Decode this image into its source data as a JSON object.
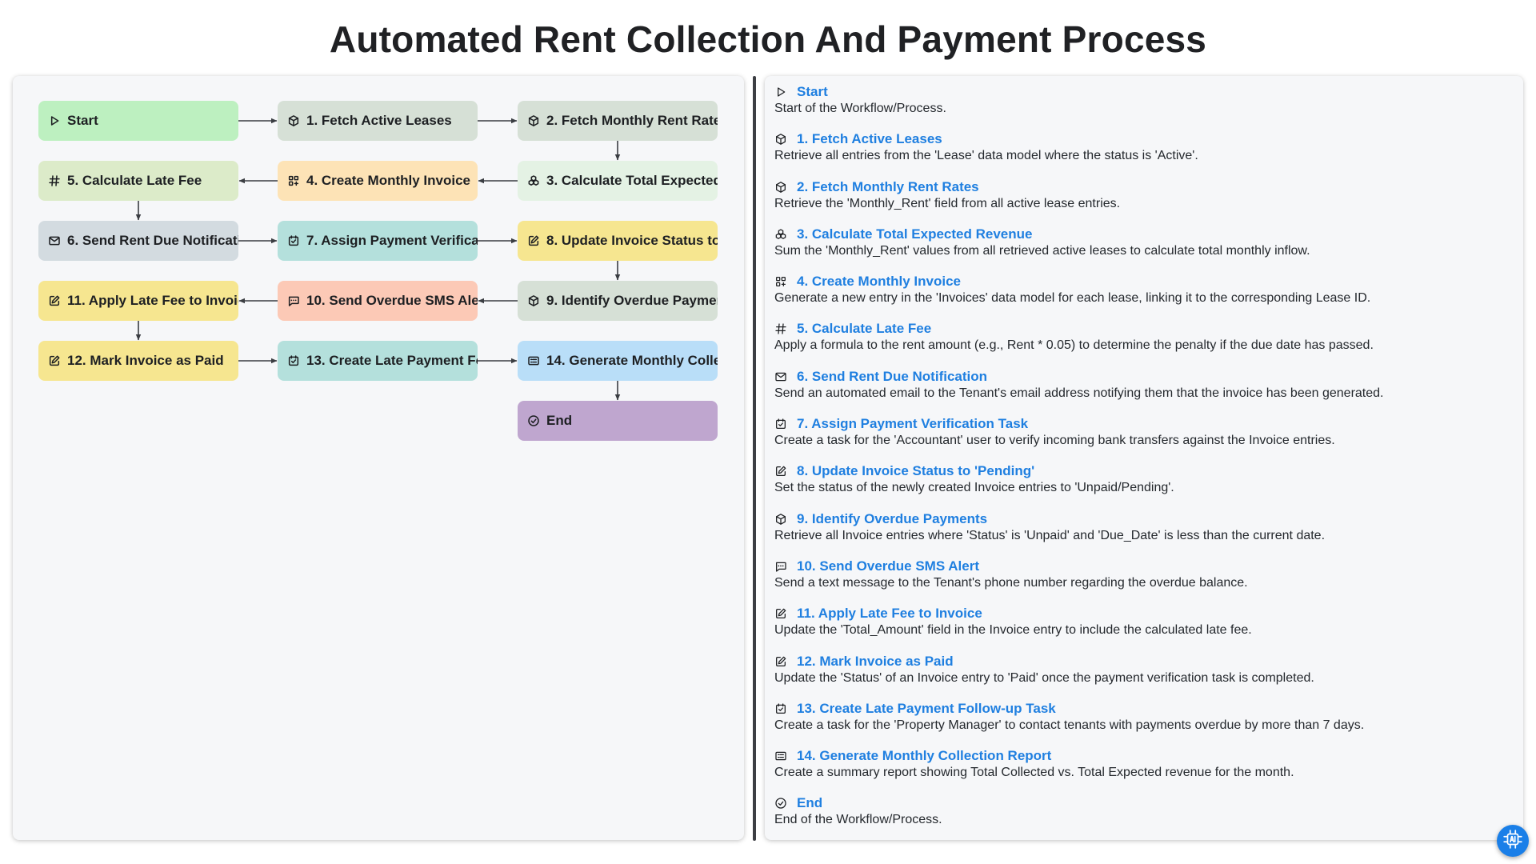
{
  "title": "Automated Rent Collection And Payment Process",
  "colors": {
    "green": "#bdf0c0",
    "gray_green": "#d6e0d6",
    "pale_green": "#e4f2e4",
    "orange": "#fde3b6",
    "lime": "#dcebc9",
    "slate": "#d3dbe0",
    "teal": "#b4e0dc",
    "yellow": "#f6e690",
    "salmon": "#fcc9b6",
    "blue": "#b9def8",
    "purple": "#bfa6cf",
    "link": "#1f7fe0"
  },
  "flow": {
    "nodes": [
      {
        "id": "start",
        "label": "Start",
        "icon": "play-icon"
      },
      {
        "id": "n1",
        "label": "1. Fetch Active Leases",
        "icon": "cube-icon"
      },
      {
        "id": "n2",
        "label": "2. Fetch Monthly Rent Rate",
        "icon": "cube-icon"
      },
      {
        "id": "n3",
        "label": "3. Calculate Total Expected",
        "icon": "cubes-icon"
      },
      {
        "id": "n4",
        "label": "4. Create Monthly Invoice",
        "icon": "grid-plus-icon"
      },
      {
        "id": "n5",
        "label": "5. Calculate Late Fee",
        "icon": "hash-icon"
      },
      {
        "id": "n6",
        "label": "6. Send Rent Due Notificati",
        "icon": "mail-icon"
      },
      {
        "id": "n7",
        "label": "7. Assign Payment Verificat",
        "icon": "calendar-check-icon"
      },
      {
        "id": "n8",
        "label": "8. Update Invoice Status to",
        "icon": "edit-icon"
      },
      {
        "id": "n9",
        "label": "9. Identify Overdue Paymer",
        "icon": "cube-icon"
      },
      {
        "id": "n10",
        "label": "10. Send Overdue SMS Ale",
        "icon": "message-icon"
      },
      {
        "id": "n11",
        "label": "11. Apply Late Fee to Invoic",
        "icon": "edit-icon"
      },
      {
        "id": "n12",
        "label": "12. Mark Invoice as Paid",
        "icon": "edit-icon"
      },
      {
        "id": "n13",
        "label": "13. Create Late Payment Fc",
        "icon": "calendar-check-icon"
      },
      {
        "id": "n14",
        "label": "14. Generate Monthly Colle",
        "icon": "report-icon"
      },
      {
        "id": "end",
        "label": "End",
        "icon": "check-circle-icon"
      }
    ]
  },
  "steps": [
    {
      "icon": "play-icon",
      "title": "Start",
      "desc": "Start of the Workflow/Process."
    },
    {
      "icon": "cube-icon",
      "title": "1. Fetch Active Leases",
      "desc": "Retrieve all entries from the 'Lease' data model where the status is 'Active'."
    },
    {
      "icon": "cube-icon",
      "title": "2. Fetch Monthly Rent Rates",
      "desc": "Retrieve the 'Monthly_Rent' field from all active lease entries."
    },
    {
      "icon": "cubes-icon",
      "title": "3. Calculate Total Expected Revenue",
      "desc": "Sum the 'Monthly_Rent' values from all retrieved active leases to calculate total monthly inflow."
    },
    {
      "icon": "grid-plus-icon",
      "title": "4. Create Monthly Invoice",
      "desc": "Generate a new entry in the 'Invoices' data model for each lease, linking it to the corresponding Lease ID."
    },
    {
      "icon": "hash-icon",
      "title": "5. Calculate Late Fee",
      "desc": "Apply a formula to the rent amount (e.g., Rent * 0.05) to determine the penalty if the due date has passed."
    },
    {
      "icon": "mail-icon",
      "title": "6. Send Rent Due Notification",
      "desc": "Send an automated email to the Tenant's email address notifying them that the invoice has been generated."
    },
    {
      "icon": "calendar-check-icon",
      "title": "7. Assign Payment Verification Task",
      "desc": "Create a task for the 'Accountant' user to verify incoming bank transfers against the Invoice entries."
    },
    {
      "icon": "edit-icon",
      "title": "8. Update Invoice Status to 'Pending'",
      "desc": "Set the status of the newly created Invoice entries to 'Unpaid/Pending'."
    },
    {
      "icon": "cube-icon",
      "title": "9. Identify Overdue Payments",
      "desc": "Retrieve all Invoice entries where 'Status' is 'Unpaid' and 'Due_Date' is less than the current date."
    },
    {
      "icon": "message-icon",
      "title": "10. Send Overdue SMS Alert",
      "desc": "Send a text message to the Tenant's phone number regarding the overdue balance."
    },
    {
      "icon": "edit-icon",
      "title": "11. Apply Late Fee to Invoice",
      "desc": "Update the 'Total_Amount' field in the Invoice entry to include the calculated late fee."
    },
    {
      "icon": "edit-icon",
      "title": "12. Mark Invoice as Paid",
      "desc": "Update the 'Status' of an Invoice entry to 'Paid' once the payment verification task is completed."
    },
    {
      "icon": "calendar-check-icon",
      "title": "13. Create Late Payment Follow-up Task",
      "desc": "Create a task for the 'Property Manager' to contact tenants with payments overdue by more than 7 days."
    },
    {
      "icon": "report-icon",
      "title": "14. Generate Monthly Collection Report",
      "desc": "Create a summary report showing Total Collected vs. Total Expected revenue for the month."
    },
    {
      "icon": "check-circle-icon",
      "title": "End",
      "desc": "End of the Workflow/Process."
    }
  ],
  "fab": {
    "icon": "ai-chip-icon"
  }
}
